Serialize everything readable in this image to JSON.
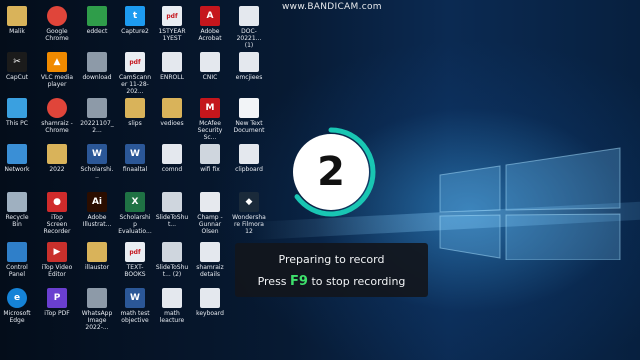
{
  "watermark": "www.BANDICAM.com",
  "countdown": {
    "value": "2",
    "progress": 0.65,
    "ring_color": "#19c6b3"
  },
  "toast": {
    "line1": "Preparing to record",
    "line2_prefix": "Press",
    "line2_key": "F9",
    "line2_suffix": "to stop recording",
    "key_color": "#3ee06c"
  },
  "desktop_icons": [
    {
      "label": "Malik",
      "icon": "folder-icon",
      "glyph": ""
    },
    {
      "label": "Google Chrome",
      "icon": "chrome-icon",
      "glyph": ""
    },
    {
      "label": "eddect",
      "icon": "green-file-icon",
      "glyph": ""
    },
    {
      "label": "Capture2",
      "icon": "twitter-icon",
      "glyph": "t"
    },
    {
      "label": "1STYEAR 1YEST",
      "icon": "pdf-file-icon",
      "glyph": "pdf"
    },
    {
      "label": "Adobe Acrobat",
      "icon": "acrobat-icon",
      "glyph": "A"
    },
    {
      "label": "DOC-20221... (1)",
      "icon": "document-icon",
      "glyph": ""
    },
    {
      "label": "CapCut",
      "icon": "capcut-icon",
      "glyph": "✂"
    },
    {
      "label": "VLC media player",
      "icon": "vlc-icon",
      "glyph": "▲"
    },
    {
      "label": "download",
      "icon": "image-file-icon",
      "glyph": ""
    },
    {
      "label": "CamScanner 11-28-202...",
      "icon": "pdf-file-icon",
      "glyph": "pdf"
    },
    {
      "label": "ENROLL",
      "icon": "document-icon",
      "glyph": ""
    },
    {
      "label": "CNIC",
      "icon": "document-icon",
      "glyph": ""
    },
    {
      "label": "emcjiees",
      "icon": "document-icon",
      "glyph": ""
    },
    {
      "label": "This PC",
      "icon": "computer-icon",
      "glyph": ""
    },
    {
      "label": "shamraiz - Chrome",
      "icon": "chrome-icon",
      "glyph": ""
    },
    {
      "label": "20221107_2...",
      "icon": "image-file-icon",
      "glyph": ""
    },
    {
      "label": "slips",
      "icon": "folder-icon",
      "glyph": ""
    },
    {
      "label": "vedioes",
      "icon": "folder-icon",
      "glyph": ""
    },
    {
      "label": "McAfee Security Sc...",
      "icon": "mcafee-icon",
      "glyph": "M"
    },
    {
      "label": "New Text Document",
      "icon": "text-file-icon",
      "glyph": ""
    },
    {
      "label": "Network",
      "icon": "network-icon",
      "glyph": ""
    },
    {
      "label": "2022",
      "icon": "folder-icon",
      "glyph": ""
    },
    {
      "label": "Scholarshi...",
      "icon": "word-file-icon",
      "glyph": "W"
    },
    {
      "label": "finaaltal",
      "icon": "word-file-icon",
      "glyph": "W"
    },
    {
      "label": "comnd",
      "icon": "document-icon",
      "glyph": ""
    },
    {
      "label": "wifi fix",
      "icon": "executable-icon",
      "glyph": ""
    },
    {
      "label": "clipboard",
      "icon": "document-icon",
      "glyph": ""
    },
    {
      "label": "Recycle Bin",
      "icon": "recycle-bin-icon",
      "glyph": ""
    },
    {
      "label": "iTop Screen Recorder",
      "icon": "itop-recorder-icon",
      "glyph": "●"
    },
    {
      "label": "Adobe Illustrat...",
      "icon": "illustrator-icon",
      "glyph": "Ai"
    },
    {
      "label": "Scholarship Evaluatio...",
      "icon": "excel-file-icon",
      "glyph": "X"
    },
    {
      "label": "SlideToShut...",
      "icon": "executable-icon",
      "glyph": ""
    },
    {
      "label": "Champ - Gunnar Olsen",
      "icon": "audio-file-icon",
      "glyph": ""
    },
    {
      "label": "Wondershare Filmora 12",
      "icon": "filmora-icon",
      "glyph": "◆"
    },
    {
      "label": "Control Panel",
      "icon": "control-panel-icon",
      "glyph": ""
    },
    {
      "label": "iTop Video Editor",
      "icon": "itop-editor-icon",
      "glyph": "▶"
    },
    {
      "label": "illaustor",
      "icon": "folder-icon",
      "glyph": ""
    },
    {
      "label": "TEXT-BOOKS",
      "icon": "pdf-file-icon",
      "glyph": "pdf"
    },
    {
      "label": "SlideToShut... (2)",
      "icon": "executable-icon",
      "glyph": ""
    },
    {
      "label": "shamraiz details",
      "icon": "document-icon",
      "glyph": ""
    },
    {
      "label": "Microsoft Edge",
      "icon": "edge-icon",
      "glyph": "e"
    },
    {
      "label": "iTop PDF",
      "icon": "itop-pdf-icon",
      "glyph": "P"
    },
    {
      "label": "WhatsApp Image 2022-...",
      "icon": "image-file-icon",
      "glyph": ""
    },
    {
      "label": "math test objective",
      "icon": "word-file-icon",
      "glyph": "W"
    },
    {
      "label": "math leacture",
      "icon": "document-icon",
      "glyph": ""
    },
    {
      "label": "keyboard",
      "icon": "document-icon",
      "glyph": ""
    }
  ]
}
